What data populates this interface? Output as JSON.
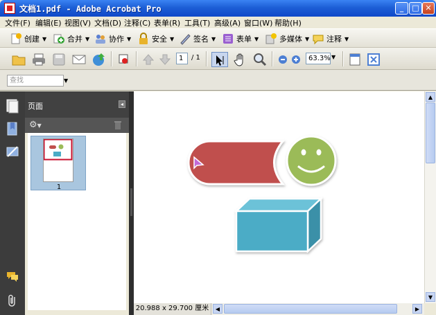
{
  "window": {
    "title": "文档1.pdf - Adobe Acrobat Pro"
  },
  "menubar": [
    "文件(F)",
    "编辑(E)",
    "视图(V)",
    "文档(D)",
    "注释(C)",
    "表单(R)",
    "工具(T)",
    "高级(A)",
    "窗口(W)",
    "帮助(H)"
  ],
  "toolbar1": {
    "create": "创建",
    "combine": "合并",
    "collaborate": "协作",
    "secure": "安全",
    "sign": "签名",
    "forms": "表单",
    "multimedia": "多媒体",
    "comment": "注释"
  },
  "toolbar2": {
    "page_current": "1",
    "page_total": "/ 1",
    "zoom": "63.3%"
  },
  "search": {
    "placeholder": "查找"
  },
  "panel": {
    "title": "页面",
    "thumbnail_label": "1"
  },
  "status": {
    "page_size": "20.988 x 29.700 厘米"
  },
  "colors": {
    "red_shape": "#c0504d",
    "smiley": "#9bbb59",
    "box": "#4bacc6"
  }
}
